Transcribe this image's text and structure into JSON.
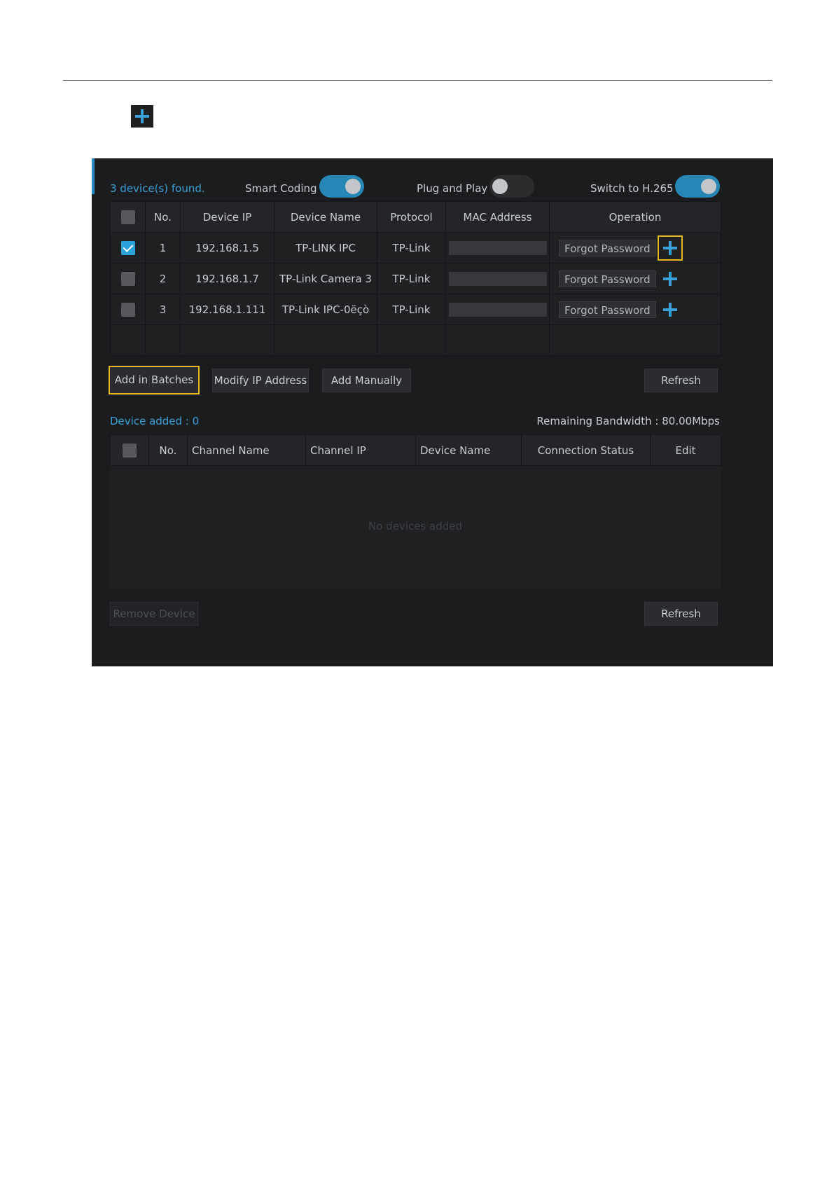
{
  "header": {
    "devices_found": "3 device(s) found.",
    "smart_coding_label": "Smart Coding",
    "plug_and_play_label": "Plug and Play",
    "switch_h265_label": "Switch to H.265"
  },
  "toggles": {
    "smart_coding_on": true,
    "plug_and_play_on": false,
    "switch_h265_on": true
  },
  "found_table": {
    "columns": [
      "No.",
      "Device IP",
      "Device Name",
      "Protocol",
      "MAC Address",
      "Operation"
    ],
    "rows": [
      {
        "no": "1",
        "ip": "192.168.1.5",
        "name": "TP-LINK IPC",
        "protocol": "TP-Link",
        "checked": true,
        "forgot": "Forgot Password"
      },
      {
        "no": "2",
        "ip": "192.168.1.7",
        "name": "TP-Link Camera 3",
        "protocol": "TP-Link",
        "checked": false,
        "forgot": "Forgot Password"
      },
      {
        "no": "3",
        "ip": "192.168.1.111",
        "name": "TP-Link IPC-0ëçò",
        "protocol": "TP-Link",
        "checked": false,
        "forgot": "Forgot Password"
      }
    ]
  },
  "actions": {
    "add_in_batches": "Add in Batches",
    "modify_ip": "Modify IP Address",
    "add_manually": "Add Manually",
    "refresh": "Refresh"
  },
  "added": {
    "device_added": "Device added : 0",
    "remaining_bandwidth": "Remaining Bandwidth : 80.00Mbps",
    "columns": [
      "No.",
      "Channel Name",
      "Channel IP",
      "Device Name",
      "Connection Status",
      "Edit"
    ],
    "empty": "No devices added",
    "remove_device": "Remove Device",
    "refresh": "Refresh"
  },
  "colors": {
    "accent": "#2a8cc4",
    "highlight": "#e7b624",
    "panel_bg": "#1b1c1e"
  },
  "icons": {
    "add": "plus-icon",
    "check": "checkmark-icon"
  }
}
